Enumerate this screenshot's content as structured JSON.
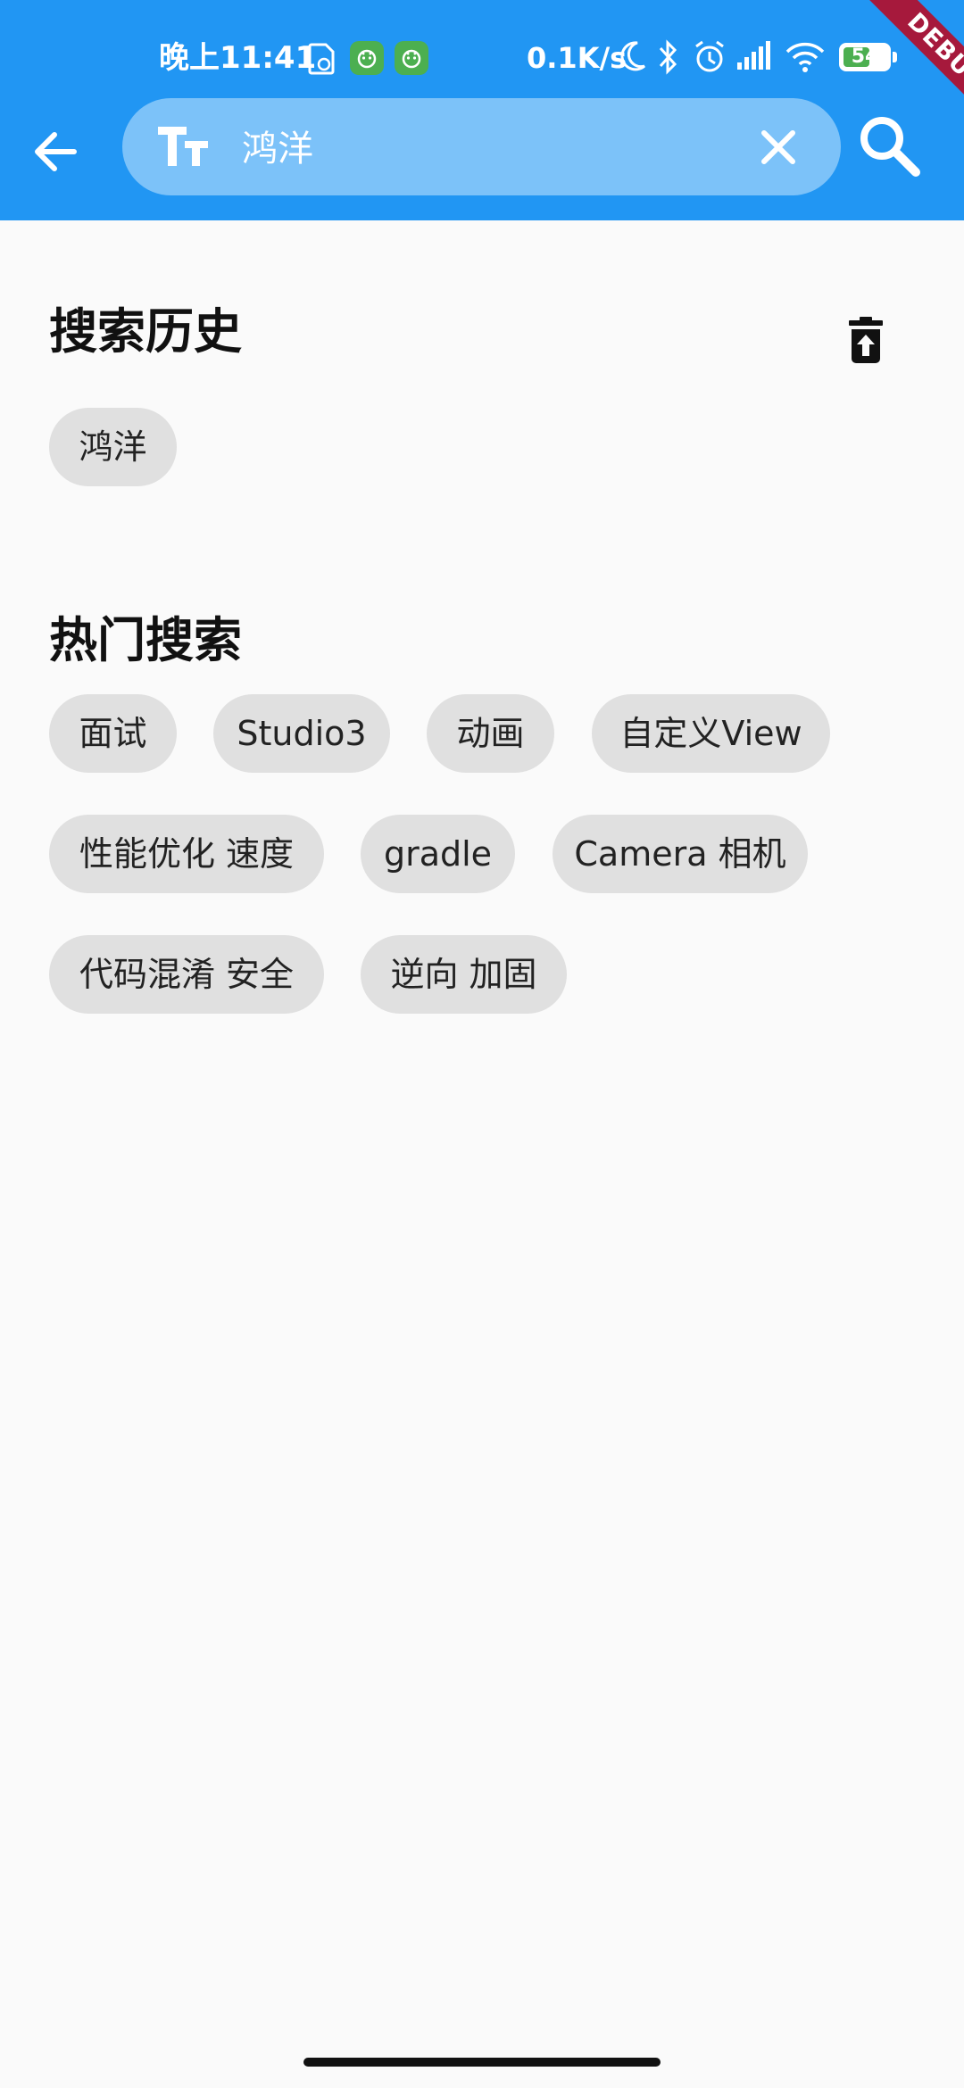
{
  "status_bar": {
    "time": "晚上11:41",
    "network_speed": "0.1K/s",
    "battery_level": "54",
    "icons": [
      "file-sync-icon",
      "app-notification-icon",
      "app-notification-icon",
      "moon-icon",
      "bluetooth-icon",
      "alarm-icon",
      "signal-icon",
      "wifi-icon",
      "battery-icon"
    ]
  },
  "debug_banner": "DEBUG",
  "app_bar": {
    "back_icon": "arrow-back-icon",
    "text_size_icon": "text-fields-icon",
    "search_value": "鸿洋",
    "clear_icon": "close-icon",
    "search_icon": "search-icon"
  },
  "history": {
    "title": "搜索历史",
    "delete_icon": "delete-restore-icon",
    "items": [
      "鸿洋"
    ]
  },
  "hot": {
    "title": "热门搜索",
    "items": [
      "面试",
      "Studio3",
      "动画",
      "自定义View",
      "性能优化 速度",
      "gradle",
      "Camera 相机",
      "代码混淆 安全",
      "逆向 加固"
    ]
  },
  "colors": {
    "app_bar": "#2196f3",
    "search_pill": "#7cc2f9",
    "chip_background": "#e0e0e0",
    "page_background": "#fafafa",
    "debug_ribbon": "#a6193c"
  }
}
